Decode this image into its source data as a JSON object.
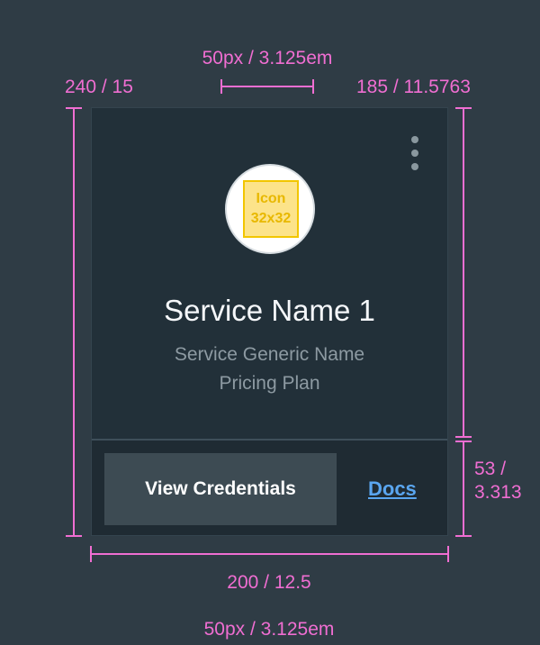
{
  "annotations": {
    "top_padding": "50px / 3.125em",
    "bottom_padding": "50px / 3.125em",
    "tile_height": "240 / 15",
    "body_height": "185 / 11.5763",
    "footer_height_line1": "53 /",
    "footer_height_line2": "3.313",
    "tile_width": "200 / 12.5"
  },
  "tile": {
    "icon_label_line1": "Icon",
    "icon_label_line2": "32x32",
    "service_name": "Service Name 1",
    "generic_name": "Service Generic Name",
    "pricing_plan": "Pricing Plan",
    "primary_button": "View Credentials",
    "docs_link": "Docs"
  },
  "colors": {
    "page_background": "#2f3c45",
    "tile_background": "#223039",
    "footer_background": "#1f2b33",
    "annotation": "#f06ed2",
    "button_background": "#3d4b53",
    "link": "#5aa6f0",
    "icon_fill": "#fce38a",
    "icon_border": "#f2c600"
  },
  "icons": {
    "overflow_menu": "vertical-ellipsis-icon",
    "service_icon": "placeholder-icon"
  }
}
